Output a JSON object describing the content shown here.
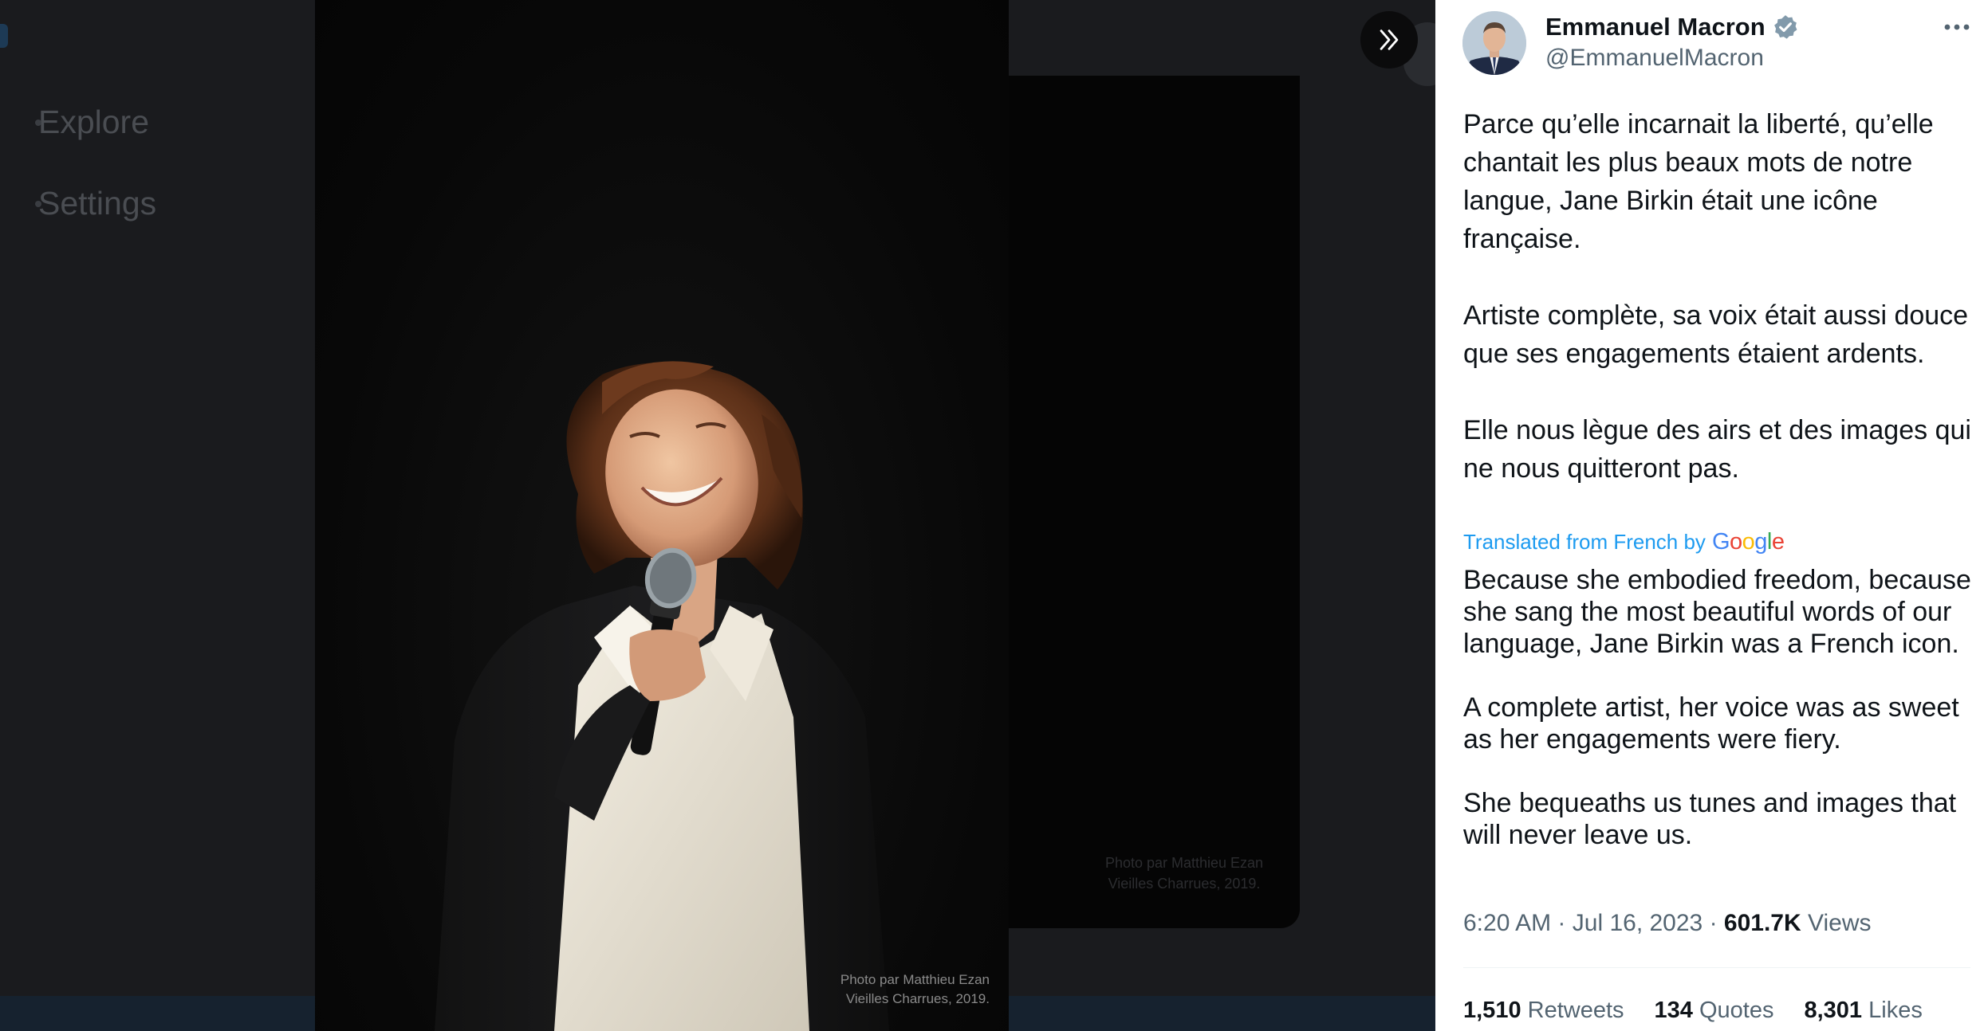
{
  "background": {
    "nav": [
      {
        "label": "Explore"
      },
      {
        "label": "Settings"
      }
    ]
  },
  "photo": {
    "credit_line1": "Photo par Matthieu Ezan",
    "credit_line2": "Vieilles Charrues, 2019."
  },
  "tweet": {
    "author_name": "Emmanuel Macron",
    "author_handle": "@EmmanuelMacron",
    "text": "Parce qu’elle incarnait la liberté, qu’elle chantait les plus beaux mots de notre langue, Jane Birkin était une icône française.\n\nArtiste complète, sa voix était aussi douce que ses engagements étaient ardents.\n\nElle nous lègue des airs et des images qui ne nous quitteront pas.",
    "translated_label": "Translated from French by",
    "translation_brand": "Google",
    "translation": "Because she embodied freedom, because she sang the most beautiful words of our language, Jane Birkin was a French icon.\n\nA complete artist, her voice was as sweet as her engagements were fiery.\n\nShe bequeaths us tunes and images that will never leave us.",
    "time": "6:20 AM",
    "date": "Jul 16, 2023",
    "views_count": "601.7K",
    "views_label": "Views",
    "separator": "·",
    "retweets_count": "1,510",
    "retweets_label": "Retweets",
    "quotes_count": "134",
    "quotes_label": "Quotes",
    "likes_count": "8,301",
    "likes_label": "Likes"
  },
  "icons": {
    "collapse": "double-chevron-right-icon",
    "verified": "verified-badge-icon",
    "more": "more-horizontal-icon"
  },
  "colors": {
    "verified_blue": "#1d9bf0",
    "link_blue": "#1d9bf0",
    "secondary_text": "#536471"
  }
}
